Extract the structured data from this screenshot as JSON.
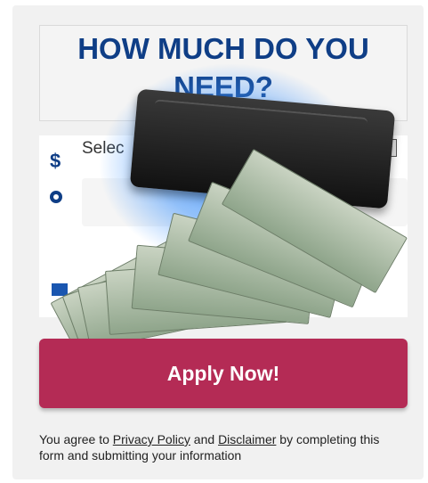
{
  "headline": "HOW MUCH DO YOU NEED?",
  "amount_select": {
    "selected_value": "Selec",
    "currency_icon": "dollar-icon"
  },
  "location_icon": "pin-icon",
  "apply_button": {
    "label": "Apply Now!"
  },
  "agreement": {
    "prefix": "You agree to ",
    "privacy_link": "Privacy Policy",
    "and": " and ",
    "disclaimer_link": "Disclaimer",
    "suffix": " by completing this form and submitting your information"
  },
  "colors": {
    "headline": "#0f3e86",
    "button": "#b42b55",
    "glow": "#4196ff"
  }
}
